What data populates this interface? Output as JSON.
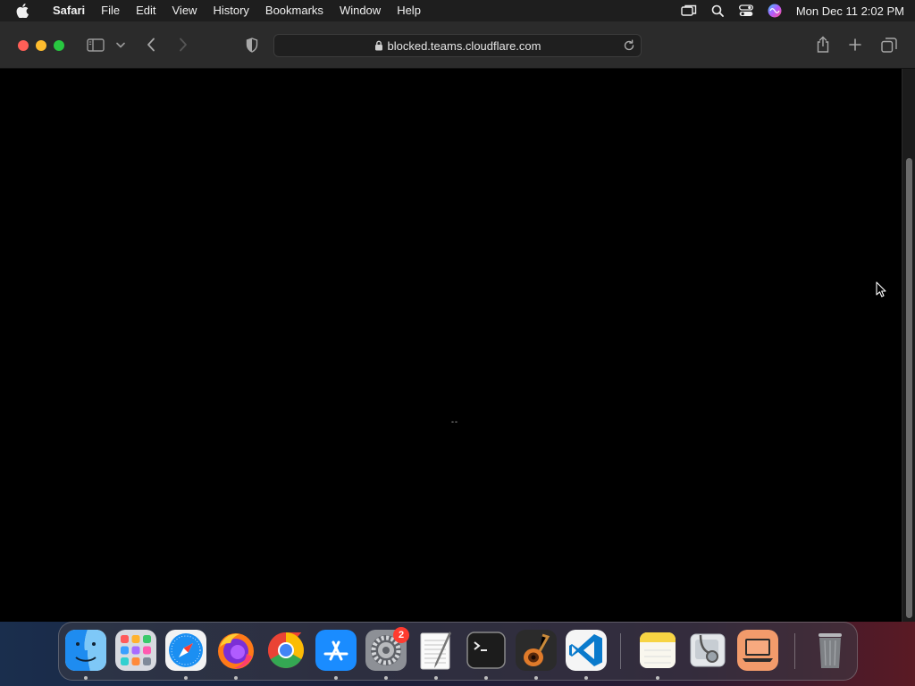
{
  "menubar": {
    "app_name": "Safari",
    "items": [
      "File",
      "Edit",
      "View",
      "History",
      "Bookmarks",
      "Window",
      "Help"
    ],
    "clock": "Mon Dec 11  2:02 PM"
  },
  "browser": {
    "url": "blocked.teams.cloudflare.com",
    "page_text": "--"
  },
  "dock": {
    "apps": [
      "Finder",
      "Launchpad",
      "Safari",
      "Firefox",
      "Google Chrome",
      "App Store",
      "System Settings",
      "TextEdit",
      "Terminal",
      "GarageBand",
      "Visual Studio Code",
      "Notes",
      "Disk Utility",
      "Screen Sharing",
      "Trash"
    ],
    "settings_badge": "2"
  },
  "colors": {
    "close": "#ff5f57",
    "minimize": "#febc2e",
    "maximize": "#28c840",
    "badge": "#ff3b30"
  }
}
